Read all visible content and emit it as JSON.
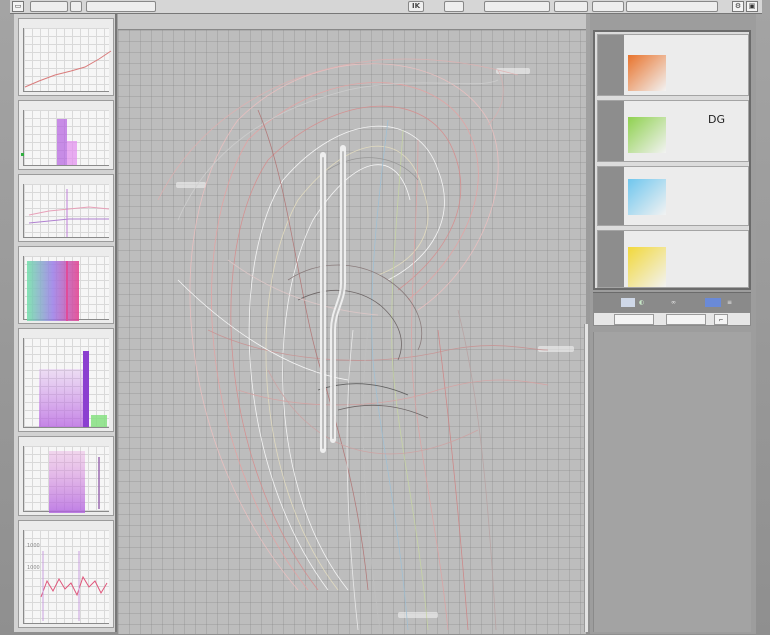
{
  "toolbar": {
    "items": [
      "",
      "",
      "",
      "",
      "IK",
      "",
      "",
      "",
      "",
      ""
    ],
    "label_ik": "IK"
  },
  "thumbnails": [
    {
      "caption": ""
    },
    {
      "caption": ""
    },
    {
      "caption": ""
    },
    {
      "caption": ""
    },
    {
      "caption": ""
    },
    {
      "caption": ""
    },
    {
      "caption": ""
    }
  ],
  "thumbnail_ticks": [
    "1000",
    "1000"
  ],
  "layers": [
    {
      "title": "",
      "swatch": "#e8732c",
      "lines": [
        "",
        "",
        ""
      ]
    },
    {
      "title": "",
      "swatch": "#8fd14f",
      "lines": [
        "",
        ""
      ],
      "badge": "DG"
    },
    {
      "title": "",
      "swatch": "#6fc6ee",
      "lines": [
        "",
        ""
      ]
    },
    {
      "title": "",
      "swatch": "#f2d83a",
      "lines": [
        "",
        "",
        ""
      ]
    }
  ],
  "panel_buttons": [
    "",
    ""
  ],
  "colors": {
    "canvas_bg": "#bdbdbd",
    "accent_orange": "#e8732c",
    "accent_green": "#8fd14f",
    "accent_blue": "#6fc6ee",
    "accent_yellow": "#f2d83a",
    "accent_purple": "#c77be0"
  }
}
